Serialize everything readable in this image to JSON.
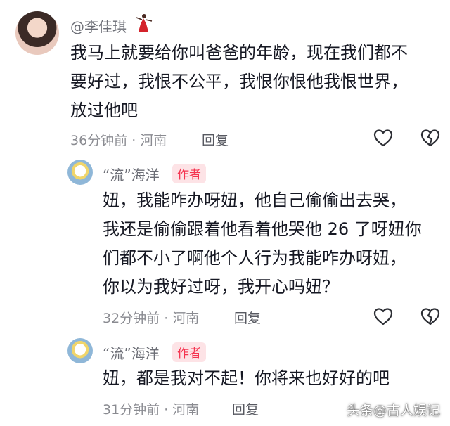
{
  "comments": [
    {
      "username": "@李佳琪",
      "lines": [
        "我马上就要给你叫爸爸的年龄，现在我们都不",
        "要好过，我恨不公平，我恨你恨他我恨世界，",
        "放过他吧"
      ],
      "meta": "36分钟前 · 河南",
      "reply_label": "回复"
    },
    {
      "username": "“流”海洋",
      "badge": "作者",
      "lines": [
        "妞，我能咋办呀妞，他自己偷偷出去哭，",
        "我还是偷偷跟着他看着他哭他 26 了呀妞你",
        "们都不小了啊他个人行为我能咋办呀妞，",
        "你以为我好过呀，我开心吗妞？"
      ],
      "meta": "32分钟前 · 河南",
      "reply_label": "回复"
    },
    {
      "username": "“流”海洋",
      "badge": "作者",
      "lines": [
        "妞，都是我对不起！你将来也好好的吧"
      ],
      "meta": "31分钟前 · 河南",
      "reply_label": "回复"
    }
  ],
  "watermark": "头条@古人娱记"
}
